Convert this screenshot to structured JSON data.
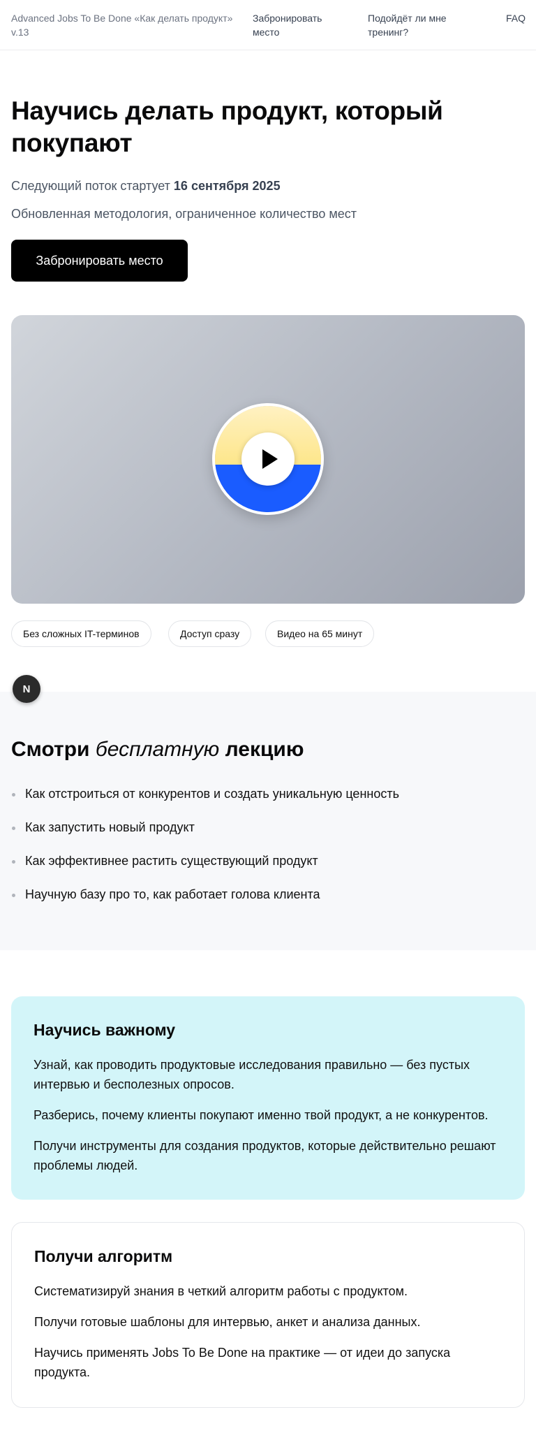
{
  "header": {
    "brand": "Advanced Jobs To Be Done «Как делать продукт» v.13",
    "nav": {
      "book": "Забронировать место",
      "fit": "Подойдёт ли мне тренинг?",
      "faq": "FAQ"
    }
  },
  "hero": {
    "title": "Научись делать продукт, который покупают",
    "next_stream_prefix": "Следующий поток стартует",
    "next_stream_date": "16 сентября 2025",
    "subtitle": "Обновленная методология, ограниченное количество мест",
    "cta_label": "Забронировать место"
  },
  "video": {
    "icon": "play-icon",
    "badge_colors": {
      "top": "#fde68a",
      "bottom": "#1a5cff"
    }
  },
  "chips": [
    "Без сложных IT-терминов",
    "Доступ сразу",
    "Видео на 65 минут"
  ],
  "floating_badge": "N",
  "lecture": {
    "title_start": "Смотри",
    "title_italic": "бесплатную",
    "title_end": "лекцию",
    "items": [
      "Как отстроиться от конкурентов и создать уникальную ценность",
      "Как запустить новый продукт",
      "Как эффективнее растить существующий продукт",
      "Научную базу про то, как работает голова клиента"
    ]
  },
  "learn_card": {
    "title": "Научись важному",
    "paragraphs": [
      "Узнай, как проводить продуктовые исследования правильно — без пустых интервью и бесполезных опросов.",
      "Разберись, почему клиенты покупают именно твой продукт, а не конкурентов.",
      "Получи инструменты для создания продуктов, которые действительно решают проблемы людей."
    ]
  },
  "algo_card": {
    "title": "Получи алгоритм",
    "paragraphs": [
      "Систематизируй знания в четкий алгоритм работы с продуктом.",
      "Получи готовые шаблоны для интервью, анкет и анализа данных.",
      "Научись применять Jobs To Be Done на практике — от идеи до запуска продукта."
    ]
  },
  "colors": {
    "cta_bg": "#000000",
    "lecture_bg": "#f7f8fa",
    "learn_card_bg": "#d3f5f9"
  }
}
